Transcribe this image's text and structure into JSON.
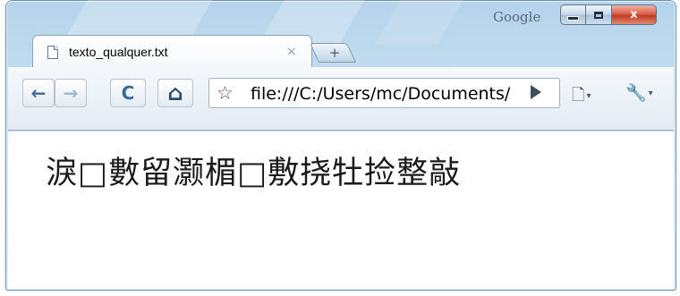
{
  "titlebar": {
    "google_label": "Google",
    "min_icon": "minimize-icon",
    "max_icon": "maximize-icon",
    "close_label": "x"
  },
  "tab": {
    "title": "texto_qualquer.txt",
    "close_label": "×",
    "icon": "page-icon"
  },
  "new_tab": {
    "label": "+"
  },
  "toolbar": {
    "back_glyph": "←",
    "forward_glyph": "→",
    "reload_glyph": "C",
    "home_glyph": "⌂",
    "star_glyph": "☆",
    "address": "file:///C:/Users/mc/Documents/texto_qualquer.txt",
    "page_menu_glyph": "🗋",
    "wrench_menu_glyph": "🔧",
    "caret": "▾"
  },
  "page": {
    "text": "淚□數留灏楣□敷挠牡捡整敲"
  }
}
